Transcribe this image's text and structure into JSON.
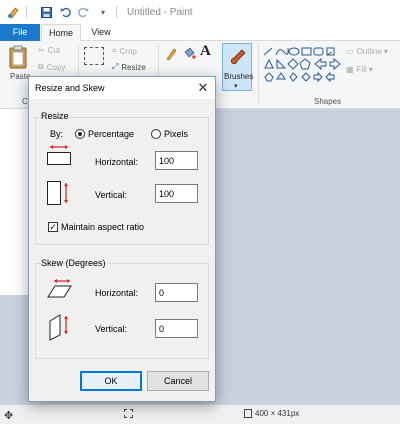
{
  "app": {
    "title": "Untitled - Paint"
  },
  "tabs": {
    "file": "File",
    "home": "Home",
    "view": "View"
  },
  "ribbon": {
    "paste": "Paste",
    "cut": "Cut",
    "copy": "Copy",
    "crop": "Crop",
    "resize": "Resize",
    "brushes": "Brushes",
    "outline": "Outline",
    "fill": "Fill",
    "shapes_group": "Shapes",
    "clipboard_group_partial": "Cl"
  },
  "dialog": {
    "title": "Resize and Skew",
    "close_glyph": "✕",
    "resize": {
      "legend": "Resize",
      "by_label": "By:",
      "percentage_label": "Percentage",
      "pixels_label": "Pixels",
      "selected_unit": "Percentage",
      "horizontal_label": "Horizontal:",
      "horizontal_value": "100",
      "vertical_label": "Vertical:",
      "vertical_value": "100",
      "maintain_label": "Maintain aspect ratio",
      "maintain_checked": true
    },
    "skew": {
      "legend": "Skew (Degrees)",
      "horizontal_label": "Horizontal:",
      "horizontal_value": "0",
      "vertical_label": "Vertical:",
      "vertical_value": "0"
    },
    "ok_label": "OK",
    "cancel_label": "Cancel"
  },
  "status": {
    "canvas_size": "400 × 431px"
  },
  "colors": {
    "accent": "#1979ca",
    "arrow_red": "#e02020"
  }
}
